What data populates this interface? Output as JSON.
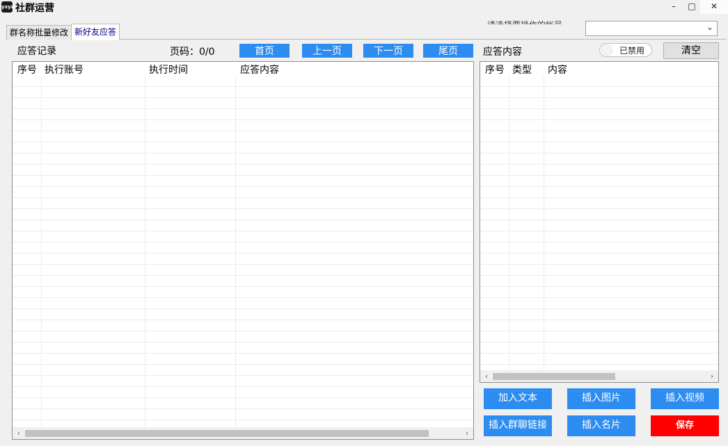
{
  "app": {
    "icon_text": "yxyzb",
    "title": "社群运营"
  },
  "window_controls": {
    "minimize": "–",
    "maximize": "□",
    "close": "✕"
  },
  "tabs": [
    {
      "label": "群名称批量修改",
      "active": false
    },
    {
      "label": "新好友应答",
      "active": true
    }
  ],
  "account_select": {
    "label_partial": "请选择要操作的帐号",
    "value": "",
    "arrow": "⌄"
  },
  "left_panel": {
    "title": "应答记录",
    "page_label": "页码：0/0",
    "buttons": {
      "first": "首页",
      "prev": "上一页",
      "next": "下一页",
      "last": "尾页"
    },
    "columns": [
      "序号",
      "执行账号",
      "执行时间",
      "应答内容"
    ]
  },
  "right_panel": {
    "title": "应答内容",
    "toggle_label": "已禁用",
    "toggle_enabled": false,
    "clear_button": "清空",
    "columns": [
      "序号",
      "类型",
      "内容"
    ],
    "actions": {
      "add_text": "加入文本",
      "insert_image": "插入图片",
      "insert_video": "插入视频",
      "insert_group_link": "插入群聊链接",
      "insert_card": "插入名片",
      "save": "保存"
    }
  },
  "colors": {
    "accent": "#2d8cf0",
    "save": "#ff0000",
    "background": "#f0f0f0"
  }
}
